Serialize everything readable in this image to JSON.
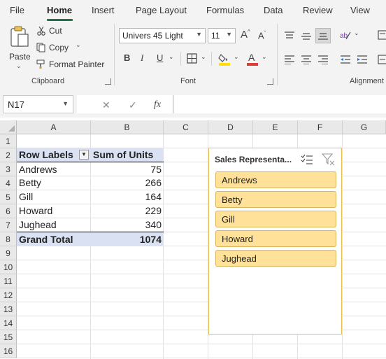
{
  "menu": {
    "tabs": [
      "File",
      "Home",
      "Insert",
      "Page Layout",
      "Formulas",
      "Data",
      "Review",
      "View"
    ],
    "active_tab": "Home"
  },
  "ribbon": {
    "clipboard": {
      "paste_label": "Paste",
      "cut_label": "Cut",
      "copy_label": "Copy",
      "format_painter_label": "Format Painter",
      "group_label": "Clipboard"
    },
    "font": {
      "font_name": "Univers 45 Light",
      "font_size": "11",
      "group_label": "Font",
      "fill_color": "#ffe000",
      "font_color": "#e03c31"
    },
    "alignment": {
      "group_label": "Alignment"
    }
  },
  "formula_bar": {
    "name_box": "N17",
    "fx_label": "fx",
    "formula": ""
  },
  "grid": {
    "columns": [
      "A",
      "B",
      "C",
      "D",
      "E",
      "F",
      "G"
    ],
    "rows": [
      "1",
      "2",
      "3",
      "4",
      "5",
      "6",
      "7",
      "8",
      "9",
      "10",
      "11",
      "12",
      "13",
      "14",
      "15",
      "16"
    ]
  },
  "pivot": {
    "header_labels": [
      "Row Labels",
      "Sum of Units"
    ],
    "rows": [
      {
        "label": "Andrews",
        "value": "75"
      },
      {
        "label": "Betty",
        "value": "266"
      },
      {
        "label": "Gill",
        "value": "164"
      },
      {
        "label": "Howard",
        "value": "229"
      },
      {
        "label": "Jughead",
        "value": "340"
      }
    ],
    "total_label": "Grand Total",
    "total_value": "1074"
  },
  "slicer": {
    "title": "Sales Representa...",
    "items": [
      "Andrews",
      "Betty",
      "Gill",
      "Howard",
      "Jughead"
    ]
  }
}
